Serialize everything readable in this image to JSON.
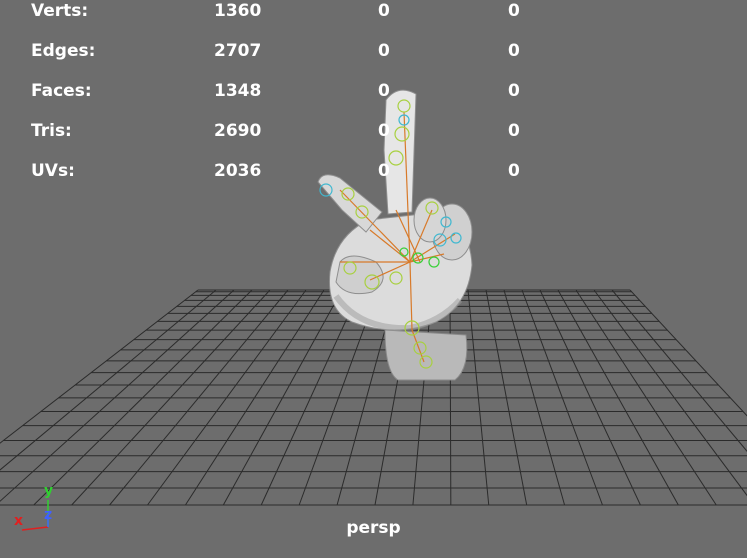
{
  "heads_up": {
    "rows": [
      {
        "label": "Verts:",
        "values": [
          "1360",
          "0",
          "0"
        ]
      },
      {
        "label": "Edges:",
        "values": [
          "2707",
          "0",
          "0"
        ]
      },
      {
        "label": "Faces:",
        "values": [
          "1348",
          "0",
          "0"
        ]
      },
      {
        "label": "Tris:",
        "values": [
          "2690",
          "0",
          "0"
        ]
      },
      {
        "label": "UVs:",
        "values": [
          "2036",
          "0",
          "0"
        ]
      }
    ]
  },
  "camera_label": "persp",
  "axis_indicator": {
    "x_label": "x",
    "y_label": "y",
    "z_label": "z",
    "x_color": "#e02020",
    "y_color": "#30d030",
    "z_color": "#4060ff"
  },
  "viewport": {
    "background_color": "#6d6d6d",
    "grid_color": "#2a2a2a",
    "model": "hand-mesh-with-rig-icon"
  }
}
